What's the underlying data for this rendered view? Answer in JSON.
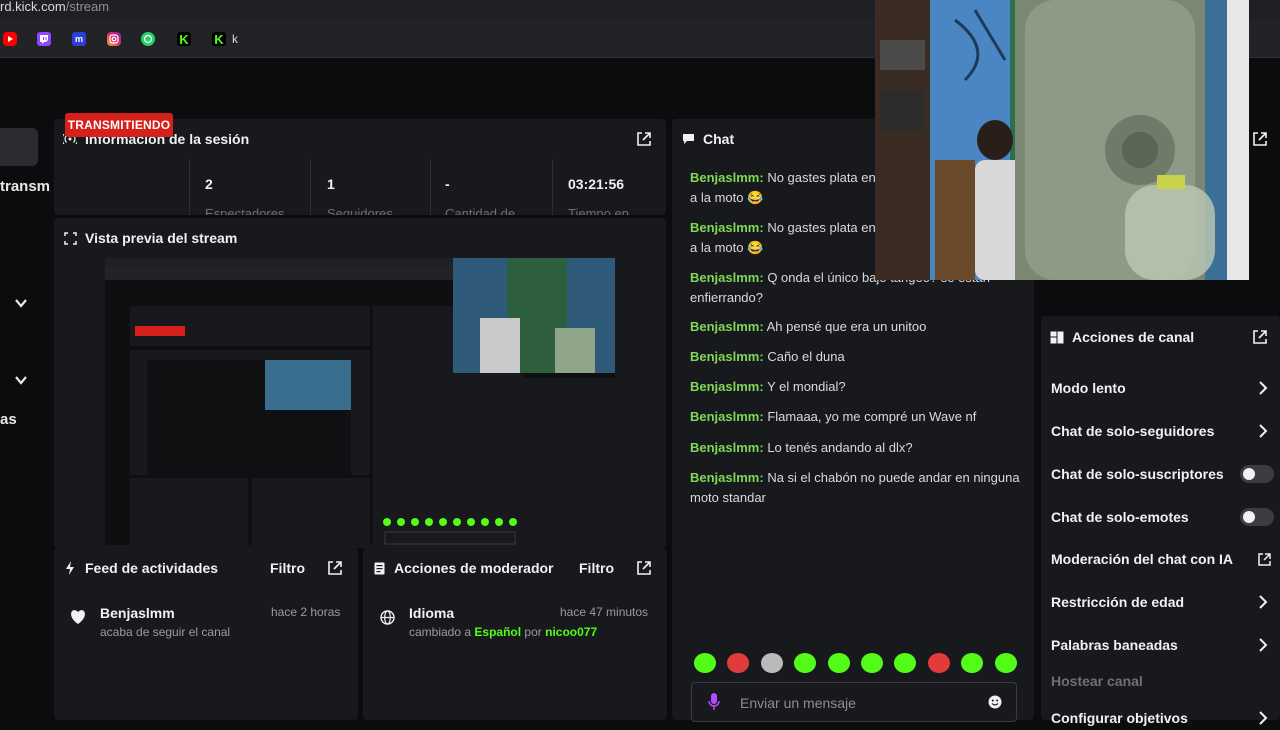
{
  "browser": {
    "url_domain": "rd.kick.com",
    "url_path": "/stream",
    "bookmarks": [
      {
        "icon": "youtube-icon",
        "color": "#ff0000"
      },
      {
        "icon": "twitch-icon",
        "color": "#9146ff"
      },
      {
        "icon": "m-icon",
        "color": "#2b3fd6",
        "glyph": "m"
      },
      {
        "icon": "instagram-icon",
        "color": "#e1306c"
      },
      {
        "icon": "whatsapp-icon",
        "color": "#25d366"
      },
      {
        "icon": "kick-icon",
        "color": "#53fc18"
      },
      {
        "icon": "kick-icon-2",
        "color": "#53fc18"
      }
    ],
    "bookmark_label": "k"
  },
  "nav": {
    "partial_label_1": "transm",
    "partial_label_2": "as"
  },
  "session": {
    "title": "Información de la sesión",
    "status": "TRANSMITIENDO",
    "stats": [
      {
        "value": "2",
        "label": "Espectadores"
      },
      {
        "value": "1",
        "label": "Seguidores"
      },
      {
        "value": "-",
        "label": "Cantidad de"
      },
      {
        "value": "03:21:56",
        "label": "Tiempo en"
      }
    ]
  },
  "preview": {
    "title": "Vista previa del stream"
  },
  "activity_feed": {
    "title": "Feed de actividades",
    "filter": "Filtro",
    "items": [
      {
        "name": "Benjaslmm",
        "time": "hace 2 horas",
        "text": "acaba de seguir el canal"
      }
    ]
  },
  "mod_actions": {
    "title": "Acciones de moderador",
    "filter": "Filtro",
    "items": [
      {
        "name": "Idioma",
        "time": "hace 47 minutos",
        "prefix": "cambiado a",
        "language": "Español",
        "by": "por",
        "moderator": "nicoo077"
      }
    ]
  },
  "chat": {
    "title": "Chat",
    "messages": [
      {
        "user": "Benjaslmm:",
        "text": "No gastes plata en la moto comprale cosas a la moto 😂"
      },
      {
        "user": "Benjaslmm:",
        "text": "No gastes plata en la moto comprale cosas a la moto 😂"
      },
      {
        "user": "Benjaslmm:",
        "text": "Q onda el único bajo tangeo? se estan enfierrando?"
      },
      {
        "user": "Benjaslmm:",
        "text": "Ah pensé que era un unitoo"
      },
      {
        "user": "Benjaslmm:",
        "text": "Caño el duna"
      },
      {
        "user": "Benjaslmm:",
        "text": "Y el mondial?"
      },
      {
        "user": "Benjaslmm:",
        "text": "Flamaaa, yo me compré un Wave nf"
      },
      {
        "user": "Benjaslmm:",
        "text": "Lo tenés andando al dlx?"
      },
      {
        "user": "Benjaslmm:",
        "text": "Na si el chabón no puede andar en ninguna moto standar"
      }
    ],
    "input_placeholder": "Enviar un mensaje",
    "emote_colors": [
      "#53fc18",
      "#e23b3b",
      "#b9b9b9",
      "#53fc18",
      "#53fc18",
      "#53fc18",
      "#53fc18",
      "#e23b3b",
      "#53fc18",
      "#53fc18"
    ]
  },
  "channel_actions": {
    "title": "Acciones de canal",
    "items": [
      {
        "label": "Modo lento",
        "control": "arrow"
      },
      {
        "label": "Chat de solo-seguidores",
        "control": "arrow"
      },
      {
        "label": "Chat de solo-suscriptores",
        "control": "toggle",
        "enabled": false
      },
      {
        "label": "Chat de solo-emotes",
        "control": "toggle",
        "enabled": false
      },
      {
        "label": "Moderación del chat con IA",
        "control": "external"
      },
      {
        "label": "Restricción de edad",
        "control": "arrow"
      },
      {
        "label": "Palabras baneadas",
        "control": "arrow"
      },
      {
        "label": "Hostear canal",
        "control": "none",
        "disabled": true
      },
      {
        "label": "Configurar objetivos",
        "control": "arrow"
      }
    ]
  }
}
